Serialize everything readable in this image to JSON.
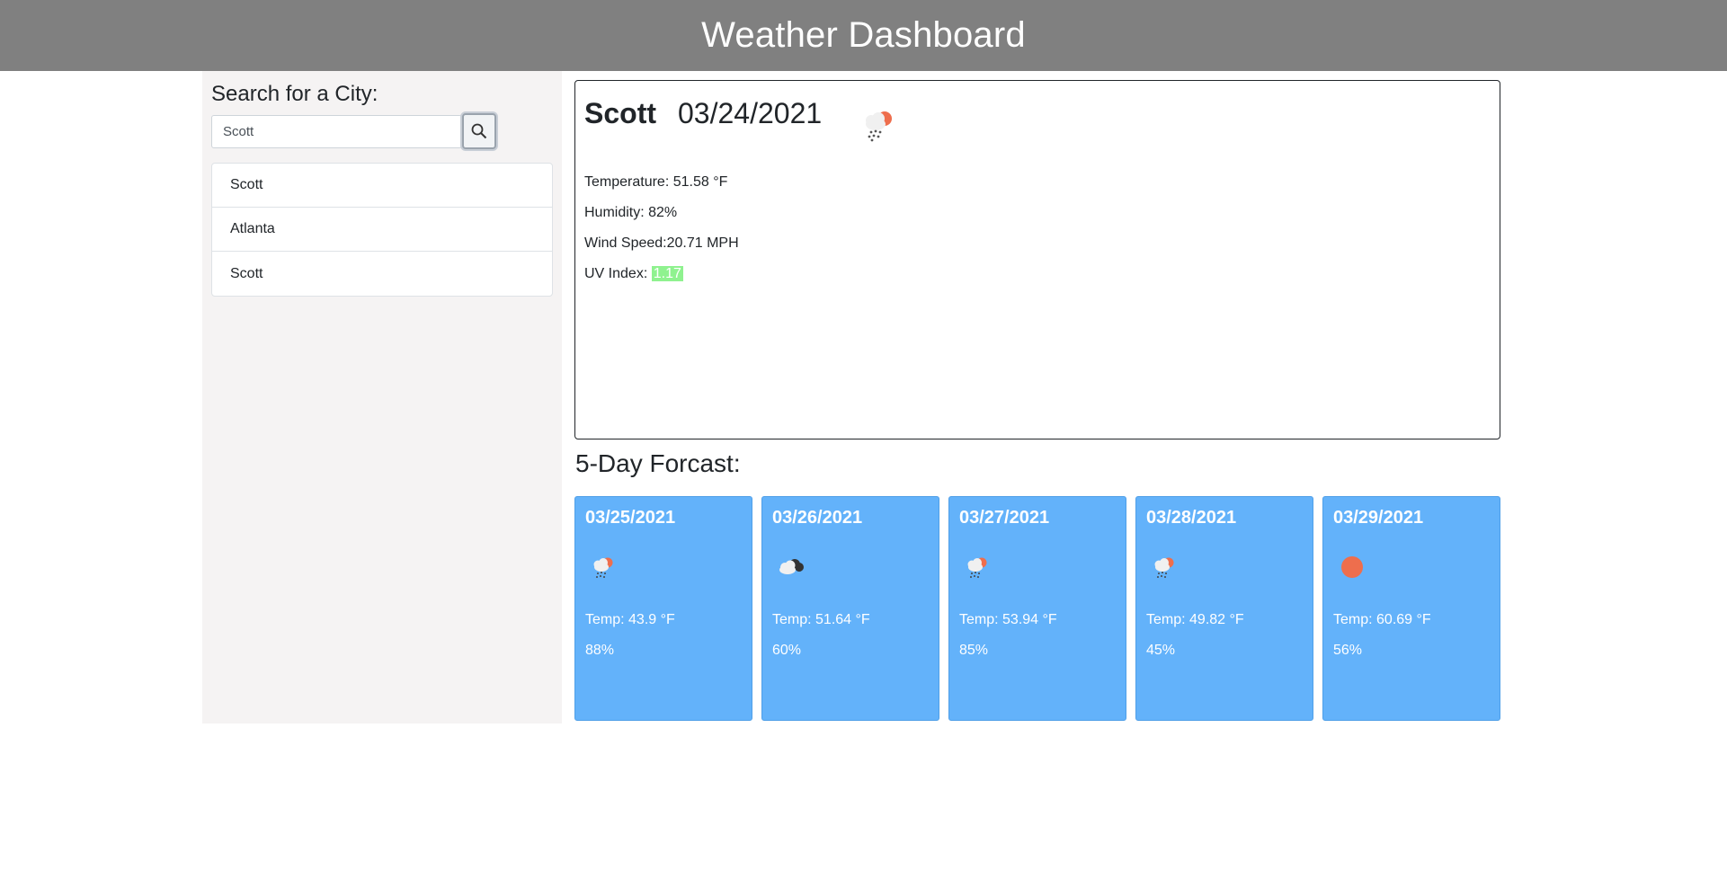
{
  "header": {
    "title": "Weather Dashboard"
  },
  "search": {
    "label": "Search for a City:",
    "value": "Scott",
    "button_icon": "search-icon"
  },
  "history": [
    "Scott",
    "Atlanta",
    "Scott"
  ],
  "current": {
    "city": "Scott",
    "date": "03/24/2021",
    "icon": "rain-sun-icon",
    "temperature": "Temperature: 51.58 °F",
    "humidity": "Humidity: 82%",
    "wind": "Wind Speed:20.71 MPH",
    "uv_label": "UV Index:",
    "uv_value": "1.17",
    "uv_color": "#8ff28f"
  },
  "forecast": {
    "title": "5-Day Forcast:",
    "card_color": "#63b2fa",
    "days": [
      {
        "date": "03/25/2021",
        "icon": "rain-sun-icon",
        "temp": "Temp: 43.9 °F",
        "humidity": "88%"
      },
      {
        "date": "03/26/2021",
        "icon": "cloudy-icon",
        "temp": "Temp: 51.64 °F",
        "humidity": "60%"
      },
      {
        "date": "03/27/2021",
        "icon": "rain-sun-icon",
        "temp": "Temp: 53.94 °F",
        "humidity": "85%"
      },
      {
        "date": "03/28/2021",
        "icon": "rain-sun-icon",
        "temp": "Temp: 49.82 °F",
        "humidity": "45%"
      },
      {
        "date": "03/29/2021",
        "icon": "sun-icon",
        "temp": "Temp: 60.69 °F",
        "humidity": "56%"
      }
    ]
  }
}
